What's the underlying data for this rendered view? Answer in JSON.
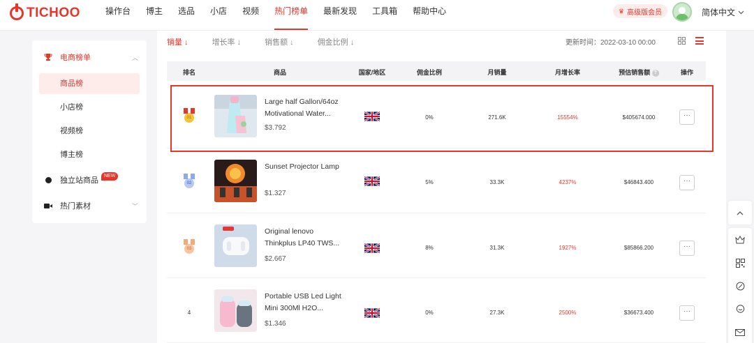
{
  "brand": {
    "name": "TICHOO"
  },
  "nav": {
    "items": [
      "操作台",
      "博主",
      "选品",
      "小店",
      "视频",
      "热门榜单",
      "最新发现",
      "工具箱",
      "帮助中心"
    ],
    "active_index": 5
  },
  "header": {
    "vip_label": "高级版会员",
    "language": "简体中文"
  },
  "sidebar": {
    "group1": "电商榜单",
    "items": [
      "商品榜",
      "小店榜",
      "视频榜",
      "博主榜"
    ],
    "group2": "独立站商品",
    "group2_badge": "NEW",
    "group3": "热门素材"
  },
  "sort_tabs": [
    "销量 ↓",
    "增长率 ↓",
    "销售额 ↓",
    "佣金比例 ↓"
  ],
  "updated_time": "更新时间：2022-03-10 00:00",
  "table": {
    "headers": [
      "排名",
      "商品",
      "国家/地区",
      "佣金比例",
      "月销量",
      "月增长率",
      "预估销售额",
      "操作"
    ],
    "rows": [
      {
        "rank": "01",
        "name_line1": "Large half Gallon/64oz",
        "name_line2": "Motivational Water...",
        "price": "$3.792",
        "commission": "0%",
        "sales": "271.6K",
        "growth": "15554%",
        "revenue": "$405674.000"
      },
      {
        "rank": "02",
        "name_line1": "Sunset Projector Lamp",
        "name_line2": "",
        "price": "$1.327",
        "commission": "5%",
        "sales": "33.3K",
        "growth": "4237%",
        "revenue": "$46843.400"
      },
      {
        "rank": "03",
        "name_line1": "Original lenovo",
        "name_line2": "Thinkplus LP40 TWS...",
        "price": "$2.667",
        "commission": "8%",
        "sales": "31.3K",
        "growth": "1927%",
        "revenue": "$85866.200"
      },
      {
        "rank": "4",
        "name_line1": "Portable USB Led Light",
        "name_line2": "Mini 300Ml H2O...",
        "price": "$1.346",
        "commission": "0%",
        "sales": "27.3K",
        "growth": "2500%",
        "revenue": "$36673.400"
      }
    ],
    "op_label": "···"
  },
  "colors": {
    "accent": "#e8352a",
    "gold": "#f3c43b",
    "silver": "#8fa9ef",
    "bronze": "#f6a877"
  }
}
